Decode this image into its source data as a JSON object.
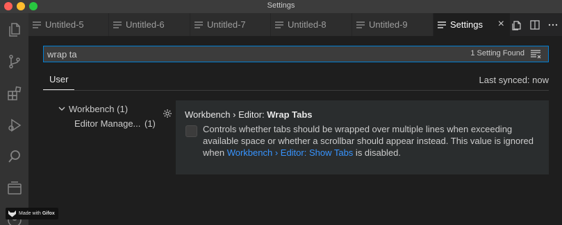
{
  "window": {
    "title": "Settings"
  },
  "activity_bar": {
    "items": [
      "explorer-icon",
      "source-control-icon",
      "extensions-icon",
      "run-debug-icon",
      "search-icon",
      "remote-explorer-icon",
      "account-icon"
    ]
  },
  "tabs": [
    {
      "label": "Untitled-5"
    },
    {
      "label": "Untitled-6"
    },
    {
      "label": "Untitled-7"
    },
    {
      "label": "Untitled-8"
    },
    {
      "label": "Untitled-9"
    },
    {
      "label": "Settings",
      "active": true,
      "close": "×"
    }
  ],
  "search": {
    "value": "wrap ta",
    "result_count": "1 Setting Found"
  },
  "scope": {
    "tab": "User",
    "last_synced": "Last synced: now"
  },
  "toc": [
    {
      "label": "Workbench",
      "count": "(1)"
    },
    {
      "label": "Editor Manage...",
      "count": "(1)"
    }
  ],
  "setting": {
    "breadcrumb": "Workbench › Editor: ",
    "name": "Wrap Tabs",
    "description_pre": "Controls whether tabs should be wrapped over multiple lines when exceeding available space or whether a scrollbar should appear instead. This value is ignored when ",
    "description_link": "Workbench › Editor: Show Tabs",
    "description_post": " is disabled.",
    "checked": false
  },
  "watermark": {
    "prefix": "Made with ",
    "brand": "Gifox"
  },
  "colors": {
    "accent": "#007fd4",
    "link": "#3794ff",
    "background": "#1e1e1e"
  }
}
